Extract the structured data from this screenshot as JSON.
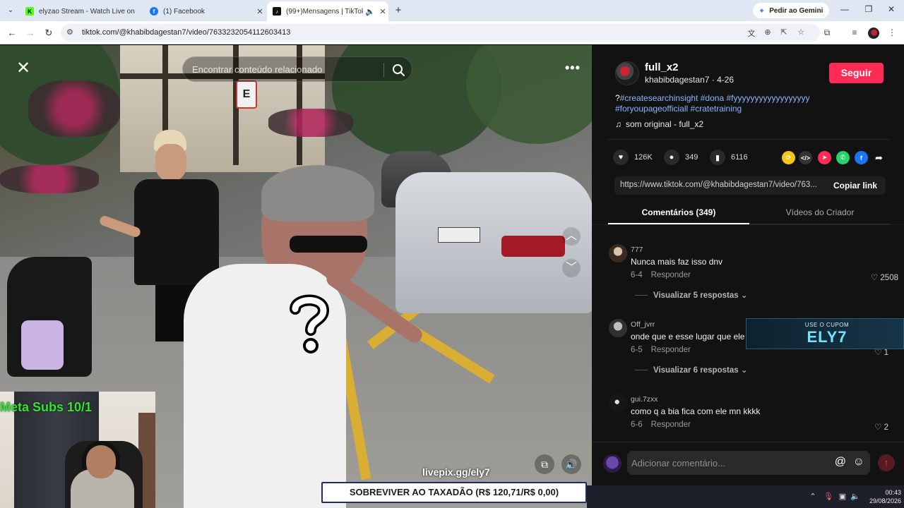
{
  "browser": {
    "tabs": [
      {
        "title": "elyzao Stream - Watch Live on",
        "favicon": "kick",
        "active": false
      },
      {
        "title": "(1) Facebook",
        "favicon": "facebook",
        "active": false
      },
      {
        "title": "(99+)Mensagens | TikTok",
        "favicon": "tiktok",
        "active": true
      }
    ],
    "gemini_label": "Pedir ao Gemini",
    "url": "tiktok.com/@khabibdagestan7/video/7633232054112603413"
  },
  "video": {
    "search_placeholder": "Encontrar conteúdo relacionado",
    "overlay_text": "livepix.gg/ely7",
    "sign_letter": "E"
  },
  "stream_overlay": {
    "meta_subs": "Meta Subs 10/1",
    "goal": "SOBREVIVER AO TAXADÃO (R$ 120,71/R$ 0,00)",
    "coupon_small": "USE O CUPOM",
    "coupon_big": "ELY7"
  },
  "post": {
    "username": "full_x2",
    "handle_date": "khabibdagestan7 · 4-26",
    "follow_label": "Seguir",
    "desc_lead": "?",
    "hashtags": "#createsearchinsight #dona #fyyyyyyyyyyyyyyyyyy #foryoupageofficiall #cratetraining",
    "music": "som original - full_x2",
    "likes": "126K",
    "comments": "349",
    "saves": "6116",
    "link": "https://www.tiktok.com/@khabibdagestan7/video/763...",
    "copy_label": "Copiar link",
    "tab_comments": "Comentários (349)",
    "tab_creator": "Vídeos do Criador"
  },
  "comments": [
    {
      "user": "777",
      "text": "Nunca mais faz isso dnv",
      "date": "6-4",
      "reply": "Responder",
      "likes": "2508",
      "replies": "Visualizar 5 respostas"
    },
    {
      "user": "Off_jvrr",
      "text": "onde que e esse lugar que ele",
      "date": "6-5",
      "reply": "Responder",
      "likes": "1",
      "replies": "Visualizar 6 respostas"
    },
    {
      "user": "gui.7zxx",
      "text": "como q a bia fica com ele mn kkkk",
      "date": "6-6",
      "reply": "Responder",
      "likes": "2",
      "replies": ""
    }
  ],
  "composer": {
    "placeholder": "Adicionar comentário..."
  },
  "system": {
    "time": "00:43",
    "date": "29/08/2026"
  },
  "colors": {
    "tiktok_red": "#fe2c55",
    "hashtag_blue": "#8ab4f8",
    "panel_bg": "#121212",
    "meta_green": "#33e533"
  }
}
